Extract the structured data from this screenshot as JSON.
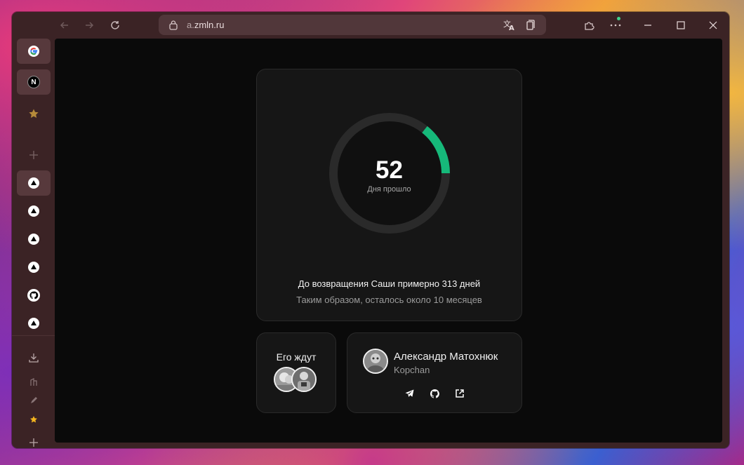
{
  "browser": {
    "url_host": "a.",
    "url_domain": "zmln.ru",
    "icons": {
      "back": "arrow-left-icon",
      "forward": "arrow-right-icon",
      "reload": "reload-icon",
      "lock": "lock-icon",
      "translate": "translate-icon",
      "collections": "collections-icon",
      "extensions": "puzzle-icon",
      "more": "more-icon",
      "minimize": "minimize-icon",
      "maximize": "maximize-icon",
      "close": "close-icon"
    }
  },
  "sidebar": {
    "items": [
      {
        "name": "google",
        "icon": "google-icon"
      },
      {
        "name": "notion",
        "icon": "n-icon"
      },
      {
        "name": "favorites",
        "icon": "star-icon"
      },
      {
        "name": "add",
        "icon": "plus-icon"
      },
      {
        "name": "vercel-1",
        "icon": "triangle-icon"
      },
      {
        "name": "vercel-2",
        "icon": "triangle-icon"
      },
      {
        "name": "vercel-3",
        "icon": "triangle-icon"
      },
      {
        "name": "vercel-4",
        "icon": "triangle-icon"
      },
      {
        "name": "github",
        "icon": "github-icon"
      },
      {
        "name": "vercel-5",
        "icon": "triangle-icon"
      }
    ],
    "bottom": [
      {
        "name": "downloads",
        "icon": "download-icon"
      },
      {
        "name": "building",
        "icon": "building-icon"
      },
      {
        "name": "pen",
        "icon": "pen-icon"
      },
      {
        "name": "star",
        "icon": "star-icon"
      },
      {
        "name": "add",
        "icon": "plus-icon"
      }
    ]
  },
  "counter": {
    "days_passed": "52",
    "days_label": "Дня прошло",
    "progress": 0.1425,
    "accent_color": "#16b97a",
    "line1": "До возвращения Саши примерно 313 дней",
    "line2": "Таким образом, осталось около 10 месяцев"
  },
  "waiting": {
    "title": "Его ждут"
  },
  "author": {
    "name": "Александр Матохнюк",
    "nickname": "Kopchan",
    "links": [
      "telegram-icon",
      "github-icon",
      "external-link-icon"
    ]
  }
}
